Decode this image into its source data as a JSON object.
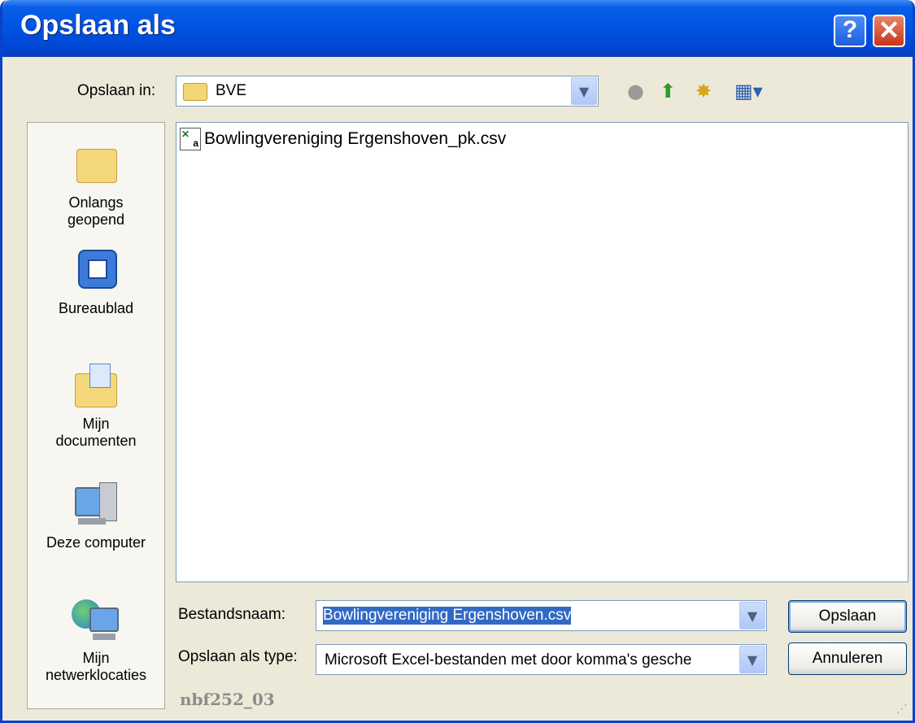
{
  "window": {
    "title": "Opslaan als"
  },
  "titlebar": {
    "help_label": "?",
    "close_label": "✕"
  },
  "save_in": {
    "label": "Opslaan in:",
    "value": "BVE"
  },
  "places": [
    {
      "label_line1": "Onlangs",
      "label_line2": "geopend",
      "icon": "recent-folder-icon"
    },
    {
      "label_line1": "Bureaublad",
      "label_line2": "",
      "icon": "desktop-icon"
    },
    {
      "label_line1": "Mijn",
      "label_line2": "documenten",
      "icon": "my-documents-icon"
    },
    {
      "label_line1": "Deze computer",
      "label_line2": "",
      "icon": "my-computer-icon"
    },
    {
      "label_line1": "Mijn",
      "label_line2": "netwerklocaties",
      "icon": "network-places-icon"
    }
  ],
  "files": [
    {
      "name": "Bowlingvereniging Ergenshoven_pk.csv",
      "icon": "csv-file-icon"
    }
  ],
  "filename": {
    "label": "Bestandsnaam:",
    "value": "Bowlingvereniging Ergenshoven.csv"
  },
  "filetype": {
    "label": "Opslaan als type:",
    "value": "Microsoft Excel-bestanden met door komma's gesche"
  },
  "buttons": {
    "save": "Opslaan",
    "cancel": "Annuleren"
  },
  "watermark": "nbf252_03",
  "colors": {
    "titlebar": "#0054e3",
    "dialog_bg": "#ece9d8",
    "selection": "#316ac5"
  }
}
